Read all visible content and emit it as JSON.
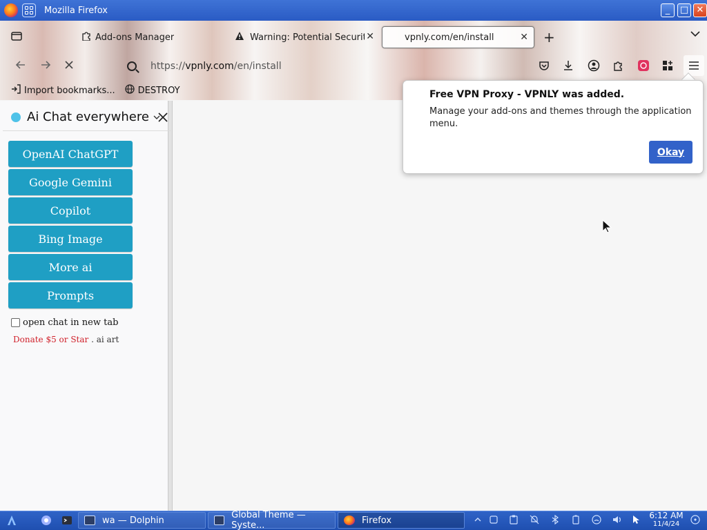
{
  "window": {
    "title": "Mozilla Firefox",
    "controls": {
      "minimize": "_",
      "maximize": "□",
      "close": "✕"
    }
  },
  "tabs": [
    {
      "label": "Add-ons Manager",
      "icon": "puzzle-icon",
      "active": false
    },
    {
      "label": "Warning: Potential Securit",
      "icon": "warning-icon",
      "active": false
    },
    {
      "label": "vpnly.com/en/install",
      "icon": "page-icon",
      "active": true
    }
  ],
  "tab_close": "✕",
  "new_tab_symbol": "+",
  "tab_list_symbol": "⌄",
  "url": {
    "prefix": "https://",
    "host": "vpnly.com",
    "path": "/en/install"
  },
  "bookmarks": [
    {
      "label": "Import bookmarks...",
      "icon": "import-icon"
    },
    {
      "label": "DESTROY",
      "icon": "globe-icon"
    }
  ],
  "sidebar": {
    "title": "Ai Chat everywhere",
    "close": "✕",
    "buttons": [
      "OpenAI ChatGPT",
      "Google Gemini",
      "Copilot",
      "Bing Image",
      "More ai",
      "Prompts"
    ],
    "checkbox_label": "open chat in new tab",
    "checkbox_checked": false,
    "donate_label": "Donate $5 or Star",
    "separator": ".",
    "ai_art_label": "ai art",
    "accent_color": "#1f9fc4"
  },
  "popup": {
    "title": "Free VPN Proxy - VPNLY was added.",
    "message": "Manage your add-ons and themes through the application menu.",
    "button": "Okay"
  },
  "taskbar": {
    "items": [
      {
        "label": "wa — Dolphin",
        "active": false
      },
      {
        "label": "Global Theme — Syste...",
        "active": false
      },
      {
        "label": "Firefox",
        "active": true
      }
    ],
    "clock_time": "6:12 AM",
    "clock_date": "11/4/24"
  }
}
